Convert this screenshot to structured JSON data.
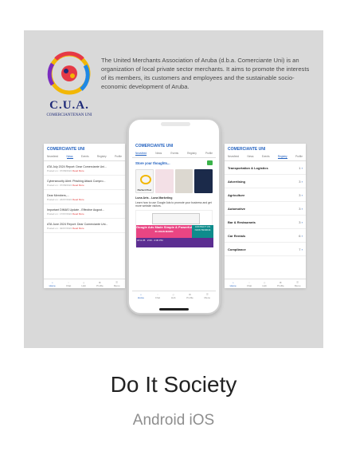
{
  "logo": {
    "abbr": "C.U.A.",
    "tagline": "COMERCIANTENAN UNI"
  },
  "description": "The United Merchants Association of Aruba (d.b.a. Comerciante Uni) is an organization of local private sector merchants. It aims to promote the interests of its members, its customers and employees and the sustainable socio-economic development of Aruba.",
  "left_screen": {
    "title": "COMERCIANTE UNI",
    "tabs": [
      "Newsfeed",
      "News",
      "Events",
      "Registry",
      "Profile"
    ],
    "active_tab": 1,
    "items": [
      {
        "text": "ATA July 2024 Report: Dear Comerciante Uni...",
        "meta": "Posted on : 07/08/2024",
        "link": "Read More"
      },
      {
        "text": "Cybersecurity Alert: Phishing Attack Compro...",
        "meta": "Posted on : 07/08/2024",
        "link": "Read More"
      },
      {
        "text": "Dear Members,...",
        "meta": "Posted on : 24/07/2024",
        "link": "Read More"
      },
      {
        "text": "Important DIMAS Update - Effective August...",
        "meta": "Posted on : 17/07/2024",
        "link": "Read More"
      },
      {
        "text": "ATA June 2024 Report: Dear Comerciante Uni...",
        "meta": "Posted on : 02/07/2024",
        "link": "Read More"
      }
    ],
    "nav": [
      "Home",
      "Chat",
      "Hub",
      "Profile",
      "Menu"
    ]
  },
  "center_screen": {
    "title": "COMERCIANTE UNI",
    "tabs": [
      "Newsfeed",
      "News",
      "Events",
      "Registry",
      "Profile"
    ],
    "active_tab": 0,
    "store_prompt": "Store your thoughts...",
    "thumb_label": "Perfect Post",
    "post_author": "Luna Arts - Luna Marketing",
    "post_text": "Learn how to use Google Ads to promote your business and get more website visitors.",
    "ad": {
      "headline": "Google Ads Made Simple & Powerful",
      "sub": "IN JOHN MARIN",
      "cta": "CONTACT US NOW 5933044",
      "date_left": "18 & 25",
      "date_right": "2:00 - 4:30 PM"
    },
    "nav": [
      "Home",
      "Chat",
      "Hub",
      "Profile",
      "Menu"
    ]
  },
  "right_screen": {
    "title": "COMERCIANTE UNI",
    "tabs": [
      "Newsfeed",
      "News",
      "Events",
      "Registry",
      "Profile"
    ],
    "active_tab": 3,
    "categories": [
      {
        "name": "Transportation & Logistics",
        "count": "1"
      },
      {
        "name": "Advertising",
        "count": "3"
      },
      {
        "name": "Agriculture",
        "count": "3"
      },
      {
        "name": "Automotive",
        "count": "3"
      },
      {
        "name": "Bar & Restaurants",
        "count": "3"
      },
      {
        "name": "Car Rentals",
        "count": "6"
      },
      {
        "name": "Compliance",
        "count": "7"
      }
    ],
    "nav": [
      "Home",
      "Chat",
      "Hub",
      "Profile",
      "Menu"
    ]
  },
  "app_name": "Do It Society",
  "platforms": "Android iOS",
  "colors": {
    "hero_bg": "#d9d9d9",
    "accent": "#1f5fbf",
    "pink": "#e94583"
  }
}
